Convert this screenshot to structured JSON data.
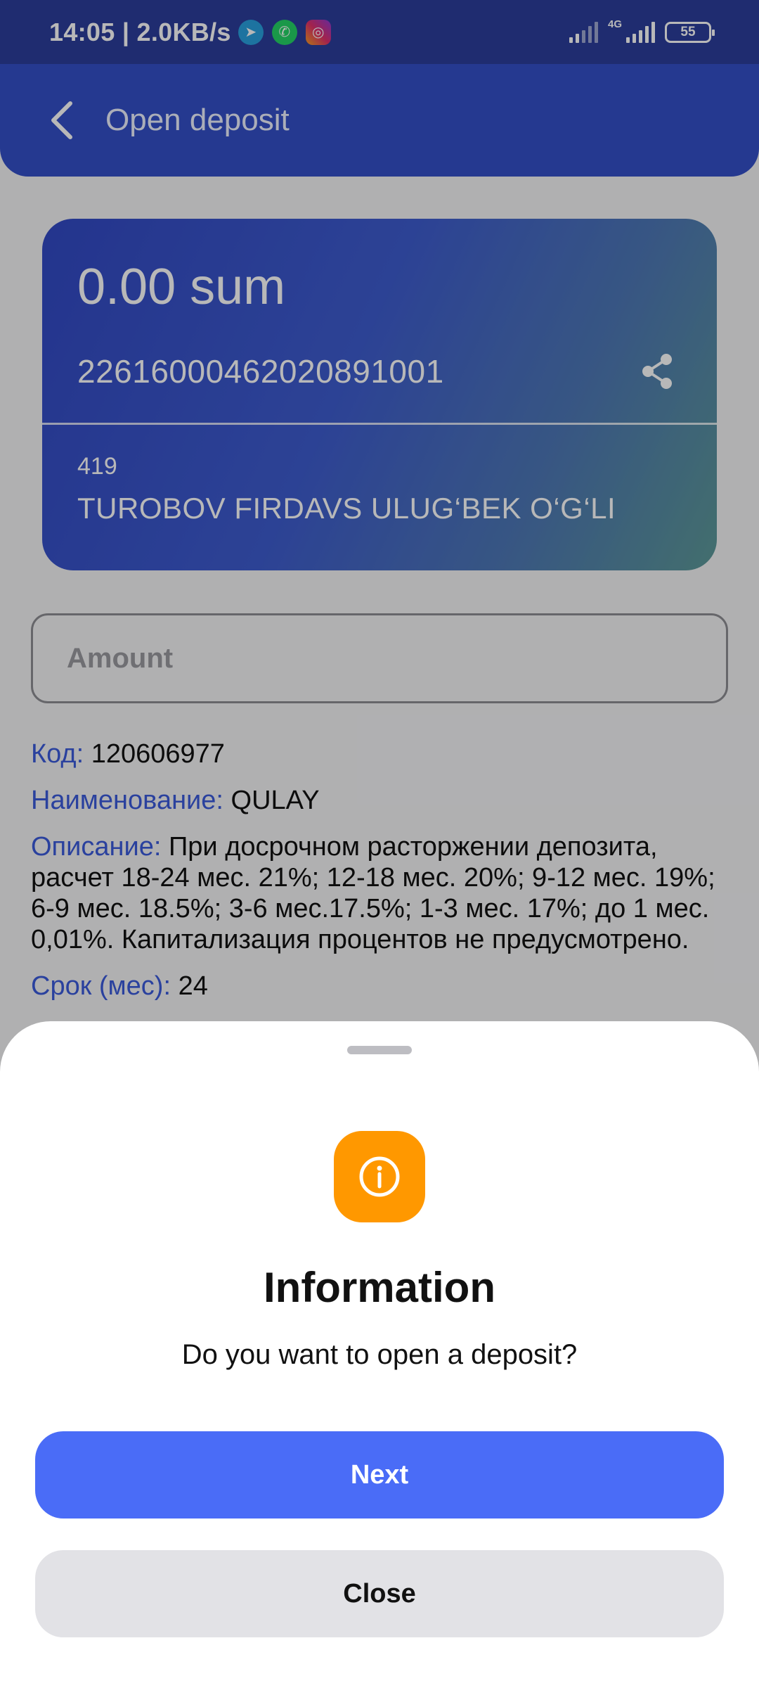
{
  "status_bar": {
    "time": "14:05 | 2.0KB/s",
    "network": "4G",
    "battery": "55"
  },
  "app_bar": {
    "title": "Open deposit"
  },
  "card": {
    "balance": "0.00 sum",
    "account_number": "22616000462020891001",
    "branch": "419",
    "holder": "TUROBOV FIRDAVS ULUG‘BEK O‘G‘LI"
  },
  "amount": {
    "placeholder": "Amount",
    "value": ""
  },
  "details": [
    {
      "key": "Код:",
      "value": "120606977"
    },
    {
      "key": "Наименование:",
      "value": "QULAY"
    },
    {
      "key": "Описание:",
      "value": "При досрочном расторжении депозита, расчет 18-24 мес. 21%; 12-18 мес. 20%; 9-12 мес. 19%; 6-9 мес. 18.5%; 3-6 мес.17.5%; 1-3 мес. 17%; до 1 мес. 0,01%. Капитализация процентов не предусмотрено."
    },
    {
      "key": "Срок (мес):",
      "value": "24"
    }
  ],
  "dialog": {
    "icon": "info-icon",
    "title": "Information",
    "message": "Do you want to open a deposit?",
    "next_label": "Next",
    "close_label": "Close"
  },
  "colors": {
    "app_bar": "#3450c8",
    "accent": "#4a6cf7",
    "info_badge": "#ff9800",
    "detail_key": "#3b5bdb"
  }
}
